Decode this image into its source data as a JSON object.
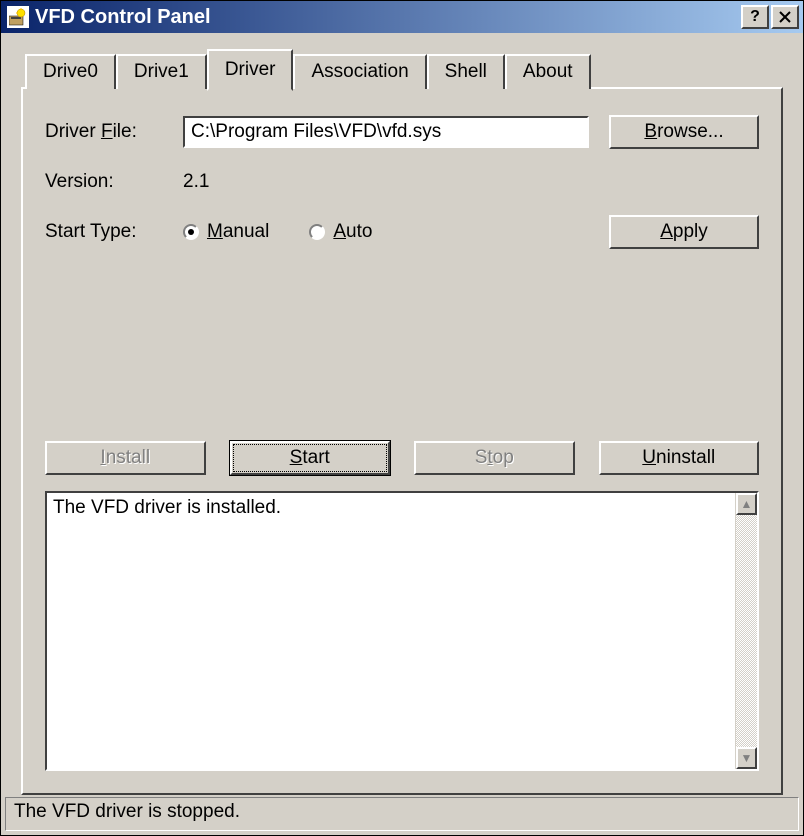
{
  "window": {
    "title": "VFD Control Panel"
  },
  "tabs": [
    {
      "label": "Drive0"
    },
    {
      "label": "Drive1"
    },
    {
      "label": "Driver"
    },
    {
      "label": "Association"
    },
    {
      "label": "Shell"
    },
    {
      "label": "About"
    }
  ],
  "active_tab_index": 2,
  "driver": {
    "file_label": "Driver File:",
    "file_value": "C:\\Program Files\\VFD\\vfd.sys",
    "browse_label": "Browse...",
    "version_label": "Version:",
    "version_value": "2.1",
    "start_type_label": "Start Type:",
    "manual_label": "Manual",
    "auto_label": "Auto",
    "start_type_selected": "manual",
    "apply_label": "Apply",
    "install_label": "Install",
    "start_label": "Start",
    "stop_label": "Stop",
    "uninstall_label": "Uninstall",
    "log_text": "The VFD driver is installed."
  },
  "statusbar": {
    "text": "The VFD driver is stopped."
  }
}
